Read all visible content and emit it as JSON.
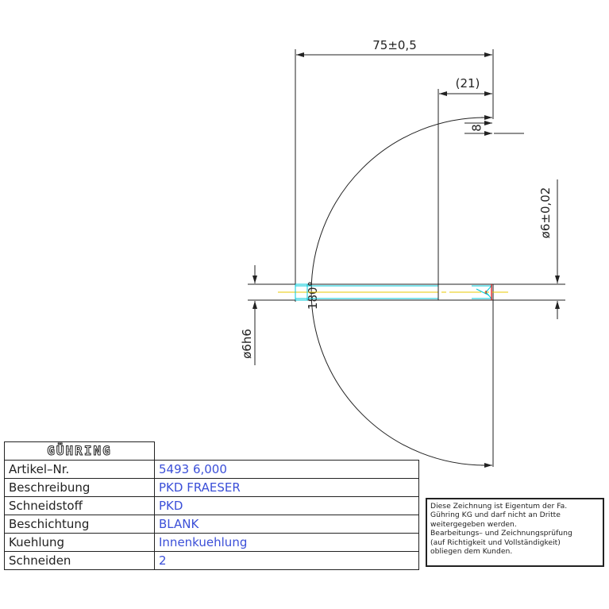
{
  "dimensions": {
    "overall_length": "75±0,5",
    "tip_length": "(21)",
    "tip_gap": "8",
    "head_diameter": "ø6±0,02",
    "shank_diameter": "ø6h6",
    "angle": "180°"
  },
  "title_block": {
    "brand": "GÜHRING",
    "rows": [
      {
        "label": "Artikel–Nr.",
        "value": "5493 6,000"
      },
      {
        "label": "Beschreibung",
        "value": "PKD FRAESER"
      },
      {
        "label": "Schneidstoff",
        "value": "PKD"
      },
      {
        "label": "Beschichtung",
        "value": "BLANK"
      },
      {
        "label": "Kuehlung",
        "value": "Innenkuehlung"
      },
      {
        "label": "Schneiden",
        "value": "2"
      }
    ]
  },
  "notice": {
    "lines": [
      "Diese Zeichnung ist Eigentum der Fa.",
      "Gühring KG und darf nicht an Dritte",
      "weitergegeben werden.",
      "Bearbeitungs– und Zeichnungsprüfung",
      "(auf Richtigkeit und Vollständigkeit)",
      "obliegen dem Kunden."
    ]
  },
  "colors": {
    "line": "#222222",
    "cyan": "#00c8d8",
    "yellow": "#e8c800",
    "red": "#e00000",
    "value_text": "#3b4fd8"
  }
}
